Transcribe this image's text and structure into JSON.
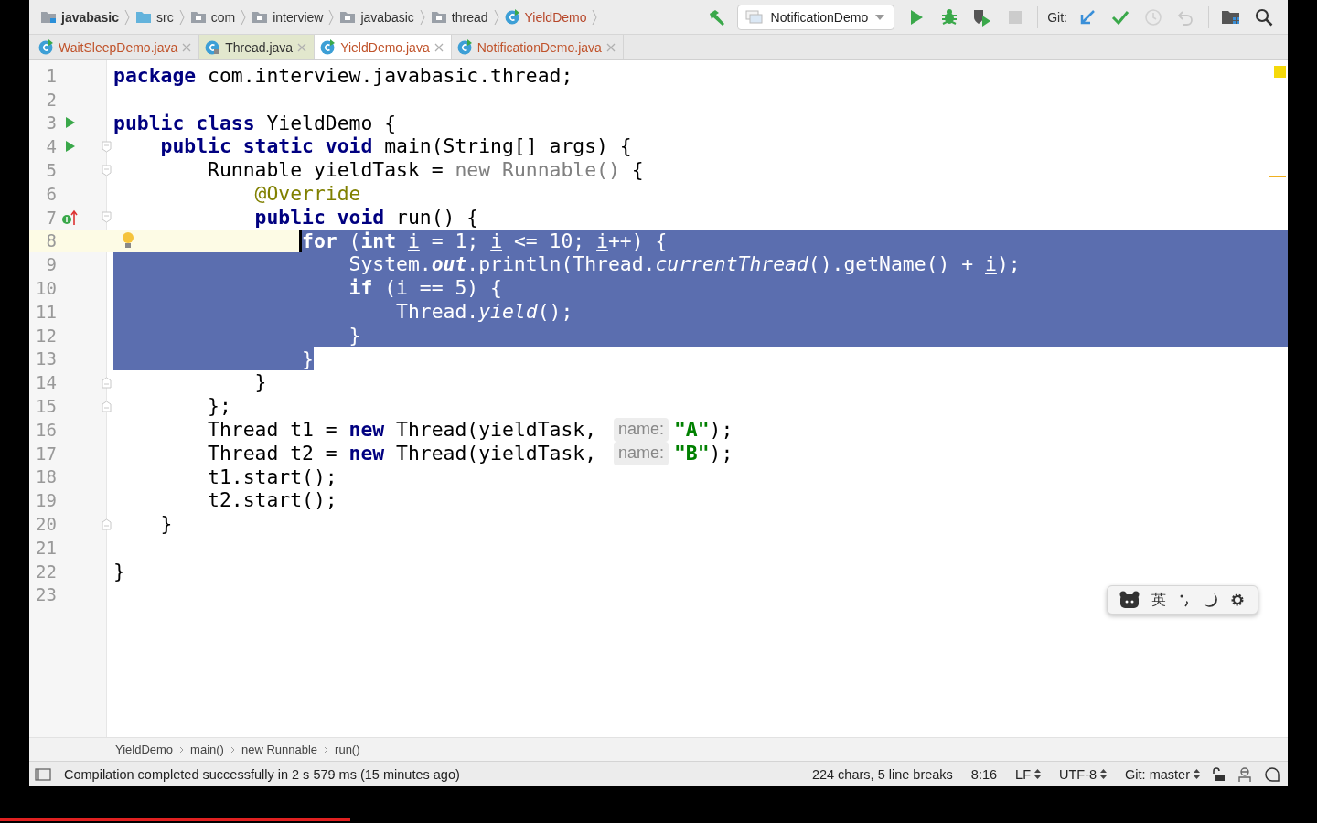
{
  "navbar": {
    "items": [
      {
        "kind": "module",
        "label": "javabasic"
      },
      {
        "kind": "source",
        "label": "src"
      },
      {
        "kind": "package",
        "label": "com"
      },
      {
        "kind": "package",
        "label": "interview"
      },
      {
        "kind": "package",
        "label": "javabasic"
      },
      {
        "kind": "package",
        "label": "thread"
      },
      {
        "kind": "class",
        "label": "YieldDemo"
      }
    ]
  },
  "toolbar": {
    "left_buttons": [
      {
        "kind": "build",
        "disabled": false
      }
    ],
    "run_config": {
      "label": "NotificationDemo"
    },
    "run_buttons": [
      {
        "kind": "run",
        "disabled": false
      },
      {
        "kind": "debug",
        "disabled": false
      },
      {
        "kind": "coverage",
        "disabled": false
      },
      {
        "kind": "stop",
        "disabled": true
      }
    ],
    "vcs_label": "Git:",
    "vcs_buttons": [
      {
        "kind": "update",
        "disabled": false
      },
      {
        "kind": "commit",
        "disabled": false
      },
      {
        "kind": "history",
        "disabled": true
      },
      {
        "kind": "revert",
        "disabled": true
      }
    ],
    "right_buttons": [
      {
        "kind": "structure",
        "disabled": false
      },
      {
        "kind": "search",
        "disabled": false
      }
    ]
  },
  "tabs": [
    {
      "label": "WaitSleepDemo.java",
      "kind": "project",
      "selected": false
    },
    {
      "label": "Thread.java",
      "kind": "library",
      "selected": false
    },
    {
      "label": "YieldDemo.java",
      "kind": "project",
      "selected": true
    },
    {
      "label": "NotificationDemo.java",
      "kind": "project",
      "selected": false
    }
  ],
  "editor": {
    "lines": [
      {
        "number": "1",
        "tokens": [
          {
            "kind": "kw",
            "text": "package"
          },
          {
            "kind": "plain",
            "text": " com.interview.javabasic.thread;"
          }
        ]
      },
      {
        "number": "2"
      },
      {
        "number": "3",
        "marker": {
          "kind": "run"
        },
        "tokens": [
          {
            "kind": "kw",
            "text": "public class"
          },
          {
            "kind": "plain",
            "text": " YieldDemo {"
          }
        ]
      },
      {
        "number": "4",
        "marker": {
          "kind": "run"
        },
        "fold": {
          "kind": "start"
        },
        "tokens": [
          {
            "kind": "kw",
            "text": "    public static void"
          },
          {
            "kind": "plain",
            "text": " main(String[] args) {"
          }
        ]
      },
      {
        "number": "5",
        "fold": {
          "kind": "start"
        },
        "tokens": [
          {
            "kind": "plain",
            "text": "        Runnable yieldTask = "
          },
          {
            "kind": "dim",
            "text": "new Runnable()"
          },
          {
            "kind": "plain",
            "text": " {"
          }
        ]
      },
      {
        "number": "6",
        "tokens": [
          {
            "kind": "ann",
            "text": "            @Override"
          }
        ]
      },
      {
        "number": "7",
        "marker": {
          "kind": "override"
        },
        "fold": {
          "kind": "start"
        },
        "tokens": [
          {
            "kind": "kw",
            "text": "            public void"
          },
          {
            "kind": "plain",
            "text": " run() {"
          }
        ]
      },
      {
        "number": "8",
        "current": true,
        "bulb": true,
        "kind": "selection_tail",
        "tokens": [
          {
            "kind": "kw",
            "text": "                for"
          },
          {
            "kind": "plain",
            "text": " ("
          },
          {
            "kind": "kw",
            "text": "int "
          },
          {
            "kind": "var",
            "text": "i"
          },
          {
            "kind": "plain",
            "text": " = 1; "
          },
          {
            "kind": "var",
            "text": "i"
          },
          {
            "kind": "plain",
            "text": " <= 10; "
          },
          {
            "kind": "var",
            "text": "i"
          },
          {
            "kind": "plain",
            "text": "++) {"
          }
        ]
      },
      {
        "number": "9",
        "kind": "selection_full",
        "tokens": [
          {
            "kind": "plain",
            "text": "                    System."
          },
          {
            "kind": "field",
            "text": "out"
          },
          {
            "kind": "plain",
            "text": ".println(Thread."
          },
          {
            "kind": "static",
            "text": "currentThread"
          },
          {
            "kind": "plain",
            "text": "().getName() + "
          },
          {
            "kind": "var",
            "text": "i"
          },
          {
            "kind": "plain",
            "text": ");"
          }
        ]
      },
      {
        "number": "10",
        "kind": "selection_full",
        "tokens": [
          {
            "kind": "kw",
            "text": "                    if"
          },
          {
            "kind": "plain",
            "text": " (i == 5) {"
          }
        ]
      },
      {
        "number": "11",
        "kind": "selection_full",
        "tokens": [
          {
            "kind": "plain",
            "text": "                        Thread."
          },
          {
            "kind": "static",
            "text": "yield"
          },
          {
            "kind": "plain",
            "text": "();"
          }
        ]
      },
      {
        "number": "12",
        "kind": "selection_full",
        "tokens": [
          {
            "kind": "plain",
            "text": "                    }"
          }
        ]
      },
      {
        "number": "13",
        "kind": "selection_head",
        "tokens": [
          {
            "kind": "plain",
            "text": "                }"
          }
        ]
      },
      {
        "number": "14",
        "fold": {
          "kind": "end"
        },
        "tokens": [
          {
            "kind": "plain",
            "text": "            }"
          }
        ]
      },
      {
        "number": "15",
        "fold": {
          "kind": "end"
        },
        "tokens": [
          {
            "kind": "plain",
            "text": "        };"
          }
        ]
      },
      {
        "number": "16",
        "tokens": [
          {
            "kind": "plain",
            "text": "        Thread t1 = "
          },
          {
            "kind": "kw",
            "text": "new"
          },
          {
            "kind": "plain",
            "text": " Thread(yieldTask, "
          },
          {
            "kind": "hint",
            "text": "name:"
          },
          {
            "kind": "str",
            "text": "\"A\""
          },
          {
            "kind": "plain",
            "text": ");"
          }
        ]
      },
      {
        "number": "17",
        "tokens": [
          {
            "kind": "plain",
            "text": "        Thread t2 = "
          },
          {
            "kind": "kw",
            "text": "new"
          },
          {
            "kind": "plain",
            "text": " Thread(yieldTask, "
          },
          {
            "kind": "hint",
            "text": "name:"
          },
          {
            "kind": "str",
            "text": "\"B\""
          },
          {
            "kind": "plain",
            "text": ");"
          }
        ]
      },
      {
        "number": "18",
        "tokens": [
          {
            "kind": "plain",
            "text": "        t1.start();"
          }
        ]
      },
      {
        "number": "19",
        "tokens": [
          {
            "kind": "plain",
            "text": "        t2.start();"
          }
        ]
      },
      {
        "number": "20",
        "fold": {
          "kind": "end"
        },
        "tokens": [
          {
            "kind": "plain",
            "text": "    }"
          }
        ]
      },
      {
        "number": "21"
      },
      {
        "number": "22",
        "tokens": [
          {
            "kind": "plain",
            "text": "}"
          }
        ]
      },
      {
        "number": "23"
      }
    ]
  },
  "breadcrumbs": [
    "YieldDemo",
    "main()",
    "new Runnable",
    "run()"
  ],
  "status_bar": {
    "message": "Compilation completed successfully in 2 s 579 ms (15 minutes ago)",
    "items": [
      {
        "kind": "plain",
        "text": "224 chars, 5 line breaks"
      },
      {
        "kind": "plain",
        "text": "8:16"
      },
      {
        "kind": "select",
        "text": "LF"
      },
      {
        "kind": "select",
        "text": "UTF-8"
      },
      {
        "kind": "select",
        "text": "Git: master"
      }
    ],
    "icons": [
      {
        "kind": "lock"
      },
      {
        "kind": "inspector"
      },
      {
        "kind": "log"
      }
    ]
  },
  "ime_toolbar": {
    "items": [
      {
        "kind": "logo"
      },
      {
        "kind": "text",
        "label": "英"
      },
      {
        "kind": "punct"
      },
      {
        "kind": "moon"
      },
      {
        "kind": "gear"
      }
    ]
  },
  "video_progress": {
    "level": 0.266
  }
}
